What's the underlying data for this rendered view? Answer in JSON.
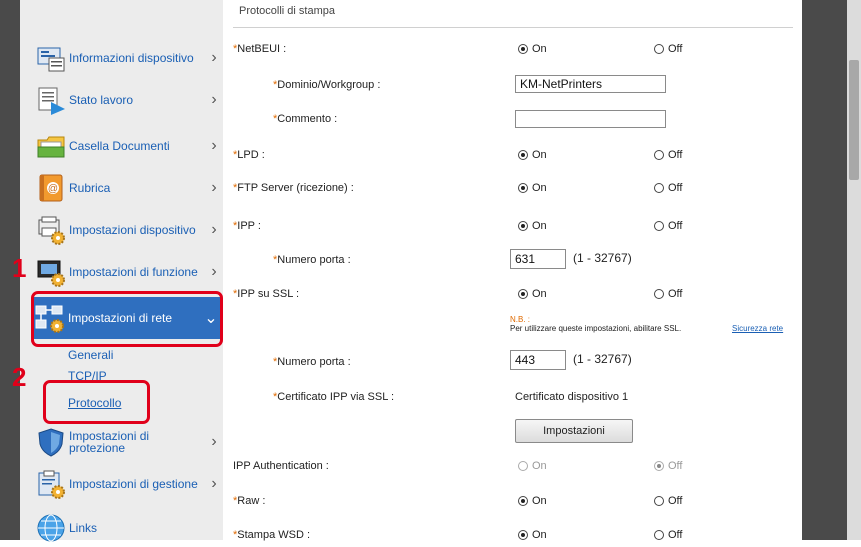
{
  "sidebar": {
    "items": [
      {
        "label": "Informazioni dispositivo",
        "icon": "device-info-icon"
      },
      {
        "label": "Stato lavoro",
        "icon": "job-status-icon"
      },
      {
        "label": "Casella Documenti",
        "icon": "document-box-icon"
      },
      {
        "label": "Rubrica",
        "icon": "address-book-icon"
      },
      {
        "label": "Impostazioni dispositivo",
        "icon": "device-settings-icon"
      },
      {
        "label": "Impostazioni di funzione",
        "icon": "function-settings-icon"
      },
      {
        "label": "Impostazioni di rete",
        "icon": "network-settings-icon",
        "expanded": true
      },
      {
        "label": "Impostazioni di protezione",
        "icon": "security-settings-icon"
      },
      {
        "label": "Impostazioni di gestione",
        "icon": "management-settings-icon"
      },
      {
        "label": "Links",
        "icon": "links-icon"
      }
    ],
    "subitems": [
      "Generali",
      "TCP/IP",
      "Protocollo"
    ]
  },
  "markers": {
    "one": "1",
    "two": "2"
  },
  "main": {
    "section_title": "Protocolli di stampa",
    "radio_on": "On",
    "radio_off": "Off",
    "rows": {
      "netbeui": "NetBEUI :",
      "dominio": "Dominio/Workgroup :",
      "commento": "Commento :",
      "lpd": "LPD :",
      "ftp": "FTP Server (ricezione) :",
      "ipp": "IPP :",
      "ipp_port_label": "Numero porta :",
      "ipp_ssl": "IPP su SSL :",
      "ssl_port_label": "Numero porta :",
      "cert_label": "Certificato IPP via SSL :",
      "ipp_auth": "IPP Authentication :",
      "raw": "Raw :",
      "wsd": "Stampa WSD :"
    },
    "values": {
      "dominio": "KM-NetPrinters",
      "commento": "",
      "ipp_port": "631",
      "ssl_port": "443",
      "port_range": "(1 - 32767)",
      "certificate": "Certificato dispositivo 1",
      "settings_button": "Impostazioni"
    },
    "note": {
      "title": "N.B. :",
      "text": "Per utilizzare queste impostazioni, abilitare SSL.",
      "link": "Sicurezza rete"
    }
  },
  "colors": {
    "accent": "#2f6fbf",
    "marker_red": "#e0001a",
    "required_star": "#e06a00"
  }
}
